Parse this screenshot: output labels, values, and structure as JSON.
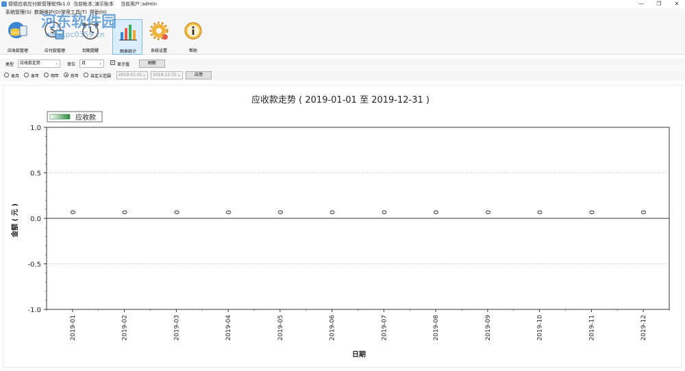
{
  "window": {
    "title": "德德应收应付款管理软件",
    "version": "v1.0",
    "account_label": "当前帐本：",
    "account_name": "演示账本",
    "user_label": "当前用户：",
    "user_name": "admin",
    "minimize": "—",
    "restore": "❐",
    "close": "✕"
  },
  "menu": {
    "items": [
      "系统管理(S)",
      "数据维护(D)",
      "常用工具(T)",
      "帮助(H)"
    ]
  },
  "watermark": {
    "line1": "河东软件园",
    "line2": "www.pc0359.cn"
  },
  "toolbar": {
    "items": [
      {
        "label": "应收款管理",
        "icon": "receivable-icon"
      },
      {
        "label": "应付款管理",
        "icon": "payable-icon"
      },
      {
        "label": "到期提醒",
        "icon": "alarm-clock-icon"
      },
      {
        "label": "图表统计",
        "icon": "bar-chart-icon"
      },
      {
        "label": "系统设置",
        "icon": "gear-icon"
      },
      {
        "label": "帮助",
        "icon": "info-icon"
      }
    ],
    "active_index": 3
  },
  "filters": {
    "type_label": "类型",
    "type_value": "应收款走势",
    "unit_label": "单位",
    "unit_value": "月",
    "show_values_label": "显示值",
    "show_values_checked": true,
    "refresh_label": "刷新",
    "ranges": [
      "本月",
      "本年",
      "明年",
      "后年",
      "自定义范围"
    ],
    "selected_range_index": 3,
    "date_from": "2019-01-01",
    "date_to": "2019-12-31",
    "apply_label": "应用"
  },
  "chart_data": {
    "type": "bar",
    "title": "应收款走势 ( 2019-01-01 至 2019-12-31 )",
    "xlabel": "日期",
    "ylabel": "金额 ( 元 )",
    "ylim": [
      -1.0,
      1.0
    ],
    "yticks": [
      "1.0",
      "0.5",
      "0.0",
      "-0.5",
      "-1.0"
    ],
    "grid": "dotted horizontal",
    "legend_position": "top-left",
    "categories": [
      "2019-01",
      "2019-02",
      "2019-03",
      "2019-04",
      "2019-05",
      "2019-06",
      "2019-07",
      "2019-08",
      "2019-09",
      "2019-10",
      "2019-11",
      "2019-12"
    ],
    "series": [
      {
        "name": "应收款",
        "color": "#2e8b3e",
        "values": [
          0,
          0,
          0,
          0,
          0,
          0,
          0,
          0,
          0,
          0,
          0,
          0
        ]
      }
    ]
  }
}
